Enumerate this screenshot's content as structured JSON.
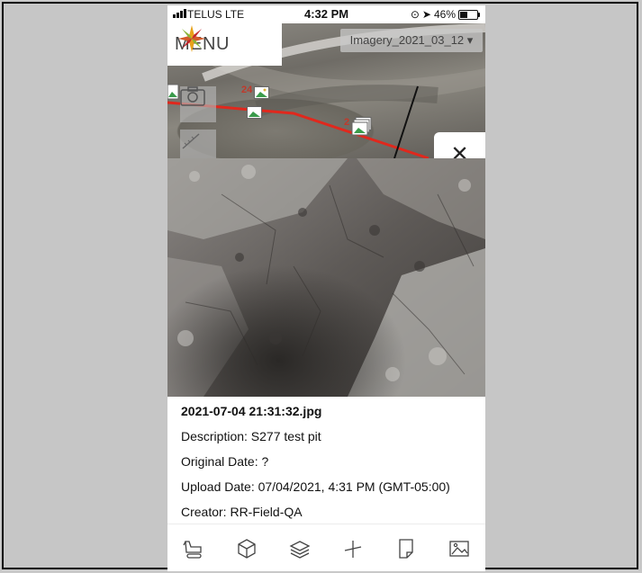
{
  "status_bar": {
    "carrier": "TELUS  LTE",
    "time": "4:32 PM",
    "battery": "46%",
    "battery_level": 0.46
  },
  "map": {
    "menu_label": "MENU",
    "imagery_selector": "Imagery_2021_03_12 ▾",
    "markers": [
      {
        "count": "24"
      },
      {
        "count": "2"
      }
    ],
    "close_label": "✕",
    "line_color": "#e0281d"
  },
  "photo": {
    "filename": "2021-07-04 21:31:32.jpg",
    "description": "Description: S277 test pit",
    "original_date": "Original Date: ?",
    "upload_date": "Upload Date: 07/04/2021, 4:31 PM (GMT-05:00)",
    "creator": "Creator: RR-Field-QA"
  },
  "toolbar": {
    "icons": [
      "excavator-icon",
      "cube-icon",
      "layers-icon",
      "measure-icon",
      "document-icon",
      "image-icon"
    ]
  }
}
